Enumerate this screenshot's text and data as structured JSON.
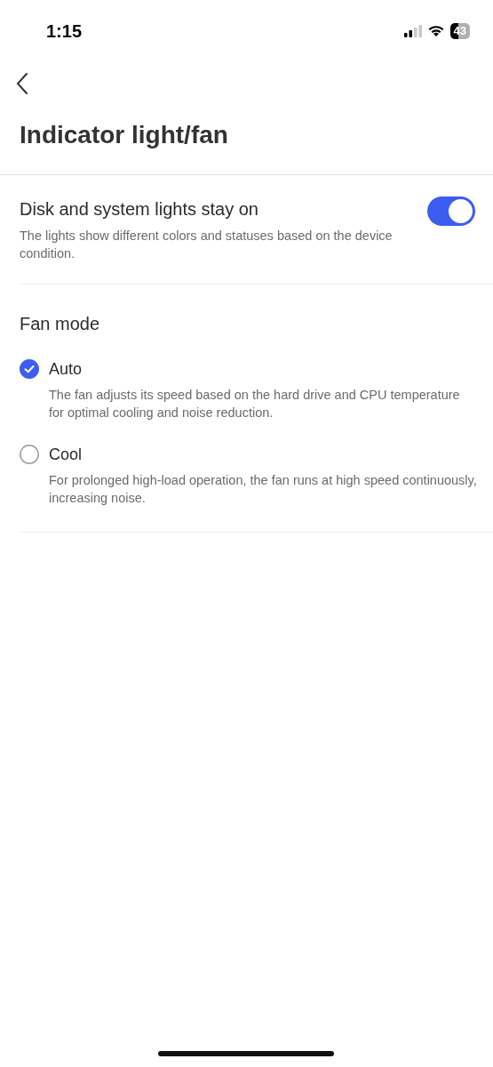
{
  "status_bar": {
    "time": "1:15",
    "battery": "43"
  },
  "header": {
    "title": "Indicator light/fan"
  },
  "lights_setting": {
    "title": "Disk and system lights stay on",
    "description": "The lights show different colors and statuses based on the device condition.",
    "on": true
  },
  "fan_mode": {
    "title": "Fan mode",
    "options": [
      {
        "label": "Auto",
        "description": "The fan adjusts its speed based on the hard drive and CPU temperature for optimal cooling and noise reduction.",
        "selected": true
      },
      {
        "label": "Cool",
        "description": "For prolonged high-load operation, the fan runs at high speed continuously, increasing noise.",
        "selected": false
      }
    ]
  }
}
